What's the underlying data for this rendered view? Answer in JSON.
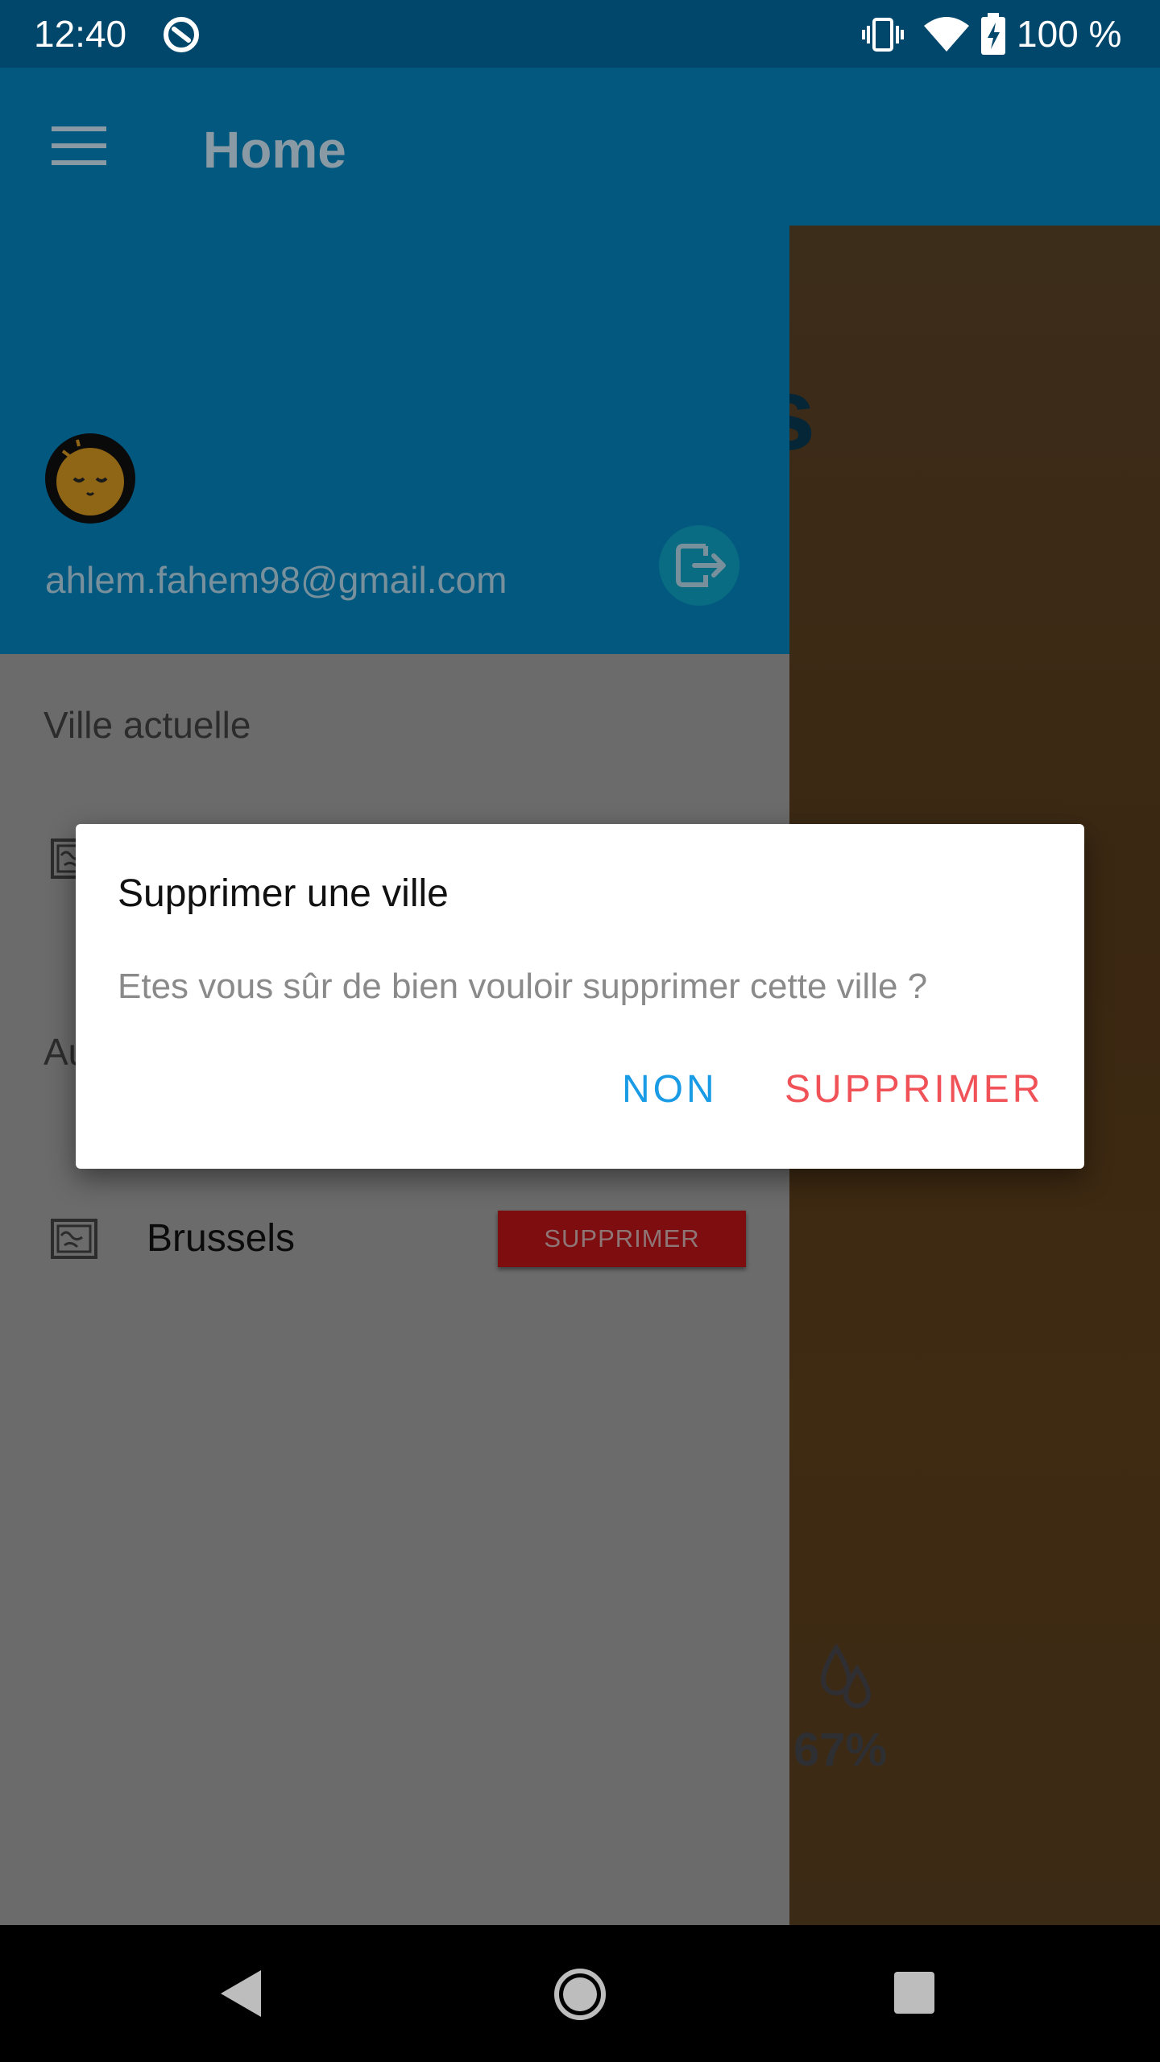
{
  "status_bar": {
    "time": "12:40",
    "battery_percent": "100 %",
    "icons": [
      "data-saver-icon",
      "vibrate-icon",
      "wifi-icon",
      "battery-charging-icon"
    ]
  },
  "app_bar": {
    "title": "Home",
    "menu_icon": "menu-icon"
  },
  "drawer": {
    "user_email": "ahlem.fahem98@gmail.com",
    "section_current": "Ville actuelle",
    "section_other_partial": "Au",
    "cities": [
      {
        "name": "Brussels",
        "action_label": "SUPPRIMER",
        "icon": "map-icon"
      }
    ]
  },
  "background": {
    "city_fragment": "es",
    "humidity": "67%"
  },
  "dialog": {
    "title": "Supprimer une ville",
    "message": "Etes vous sûr de bien vouloir supprimer cette ville ?",
    "negative_button": "NON",
    "positive_button": "SUPPRIMER"
  },
  "colors": {
    "primary": "#01476c",
    "negative_button": "#1a9be6",
    "positive_button": "#f05258",
    "delete_chip": "#7e0d10"
  }
}
